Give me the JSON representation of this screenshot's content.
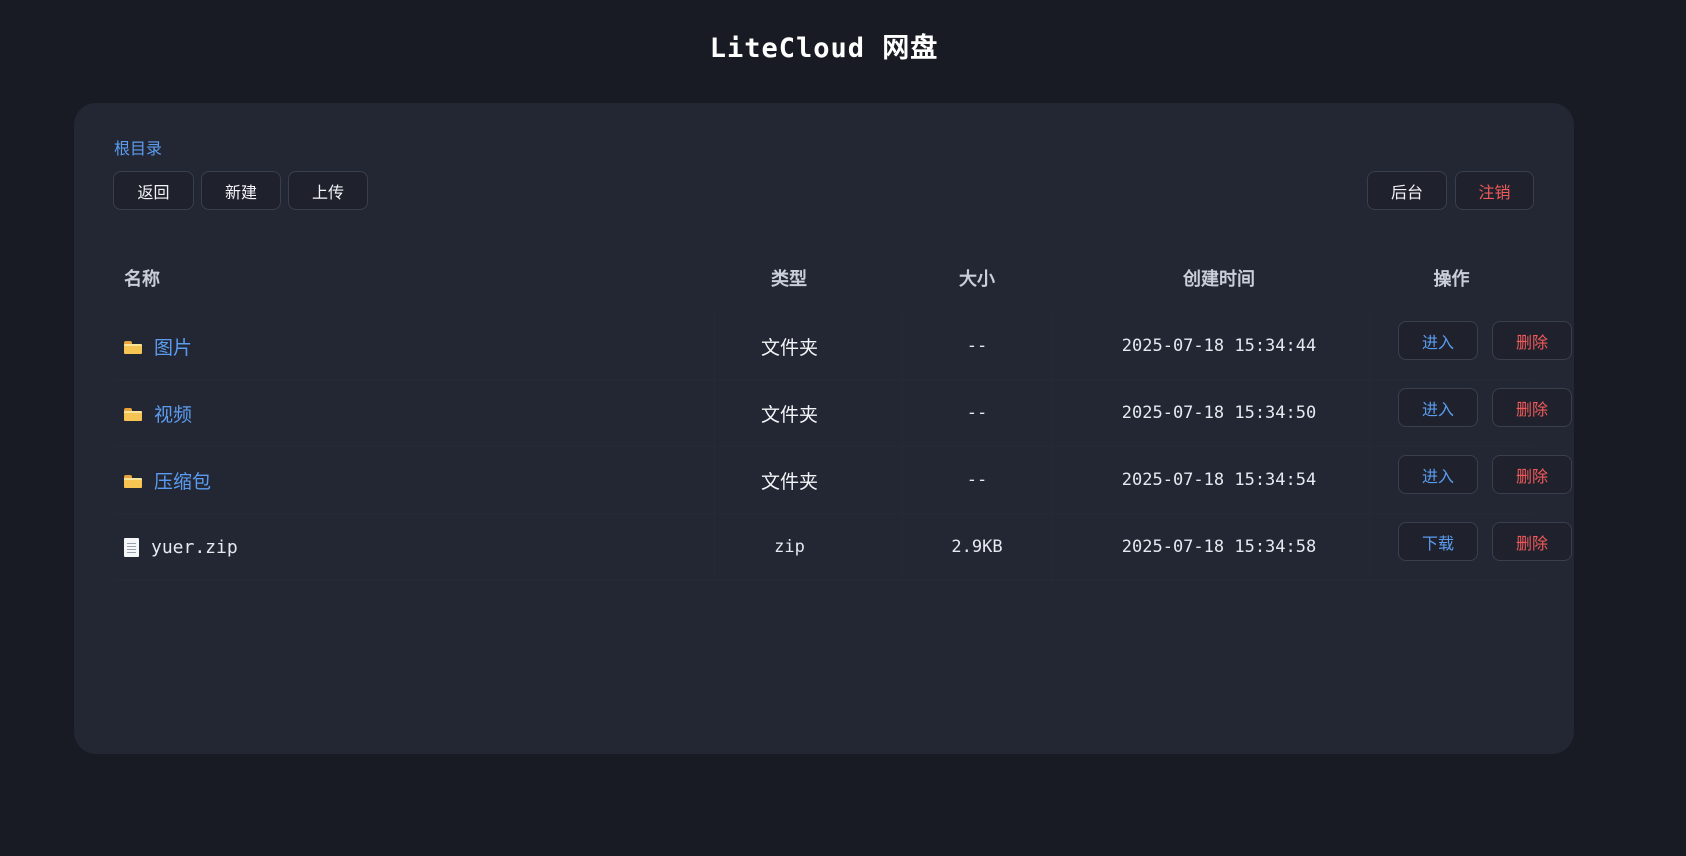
{
  "app": {
    "title": "LiteCloud 网盘"
  },
  "breadcrumb": {
    "root": "根目录"
  },
  "toolbar": {
    "back_label": "返回",
    "new_label": "新建",
    "upload_label": "上传",
    "admin_label": "后台",
    "logout_label": "注销"
  },
  "table": {
    "headers": {
      "name": "名称",
      "type": "类型",
      "size": "大小",
      "time": "创建时间",
      "ops": "操作"
    },
    "rows": [
      {
        "icon": "folder-icon",
        "name": "图片",
        "type": "文件夹",
        "size": "--",
        "created": "2025-07-18 15:34:44",
        "primary_action": "进入",
        "delete_action": "删除"
      },
      {
        "icon": "folder-icon",
        "name": "视频",
        "type": "文件夹",
        "size": "--",
        "created": "2025-07-18 15:34:50",
        "primary_action": "进入",
        "delete_action": "删除"
      },
      {
        "icon": "folder-icon",
        "name": "压缩包",
        "type": "文件夹",
        "size": "--",
        "created": "2025-07-18 15:34:54",
        "primary_action": "进入",
        "delete_action": "删除"
      },
      {
        "icon": "file-icon",
        "name": "yuer.zip",
        "type": "zip",
        "size": "2.9KB",
        "created": "2025-07-18 15:34:58",
        "primary_action": "下载",
        "delete_action": "删除"
      }
    ]
  },
  "colors": {
    "background": "#181b23",
    "panel": "#232733",
    "accent": "#5b9cf0",
    "danger": "#f05a5a",
    "folder": "#f6c453"
  }
}
